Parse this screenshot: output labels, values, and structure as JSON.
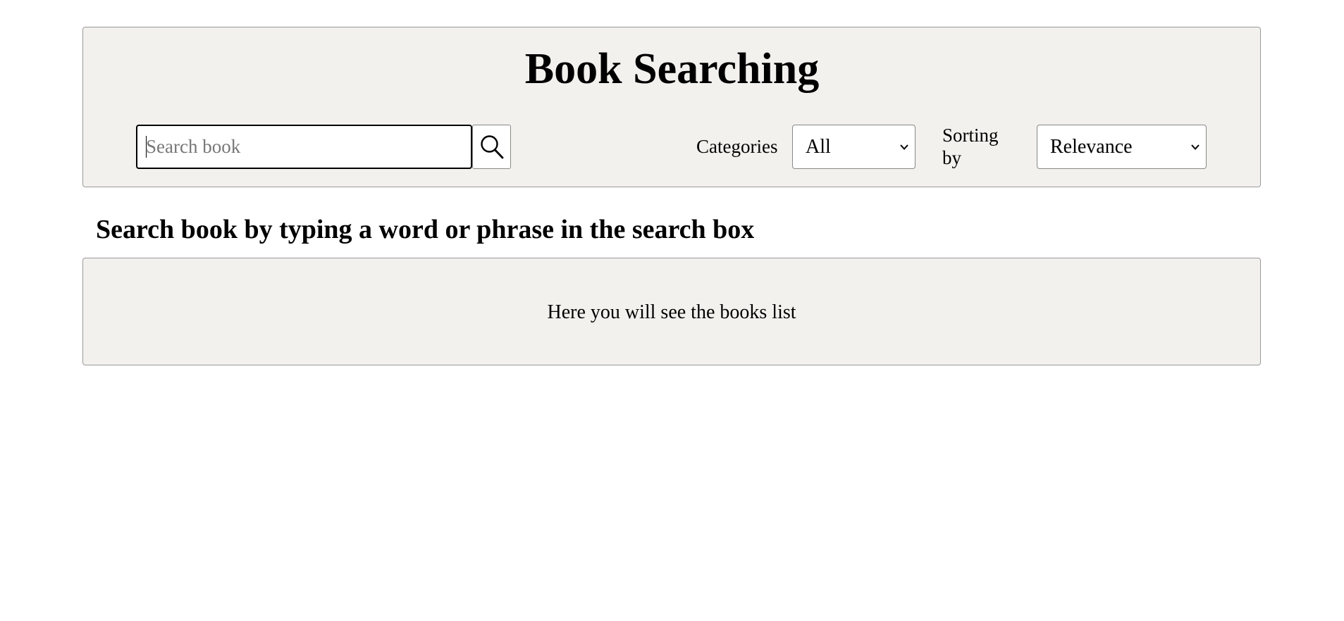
{
  "header": {
    "title": "Book Searching",
    "search": {
      "placeholder": "Search book",
      "value": "",
      "button_icon": "search-icon"
    },
    "categories": {
      "label": "Categories",
      "selected": "All"
    },
    "sorting": {
      "label": "Sorting by",
      "selected": "Relevance"
    }
  },
  "main": {
    "instruction": "Search book by typing a word or phrase in the search box",
    "results_placeholder": "Here you will see the books list"
  },
  "colors": {
    "panel_background": "#f2f1ee",
    "panel_border": "#9a9a9a",
    "page_background": "#ffffff"
  }
}
